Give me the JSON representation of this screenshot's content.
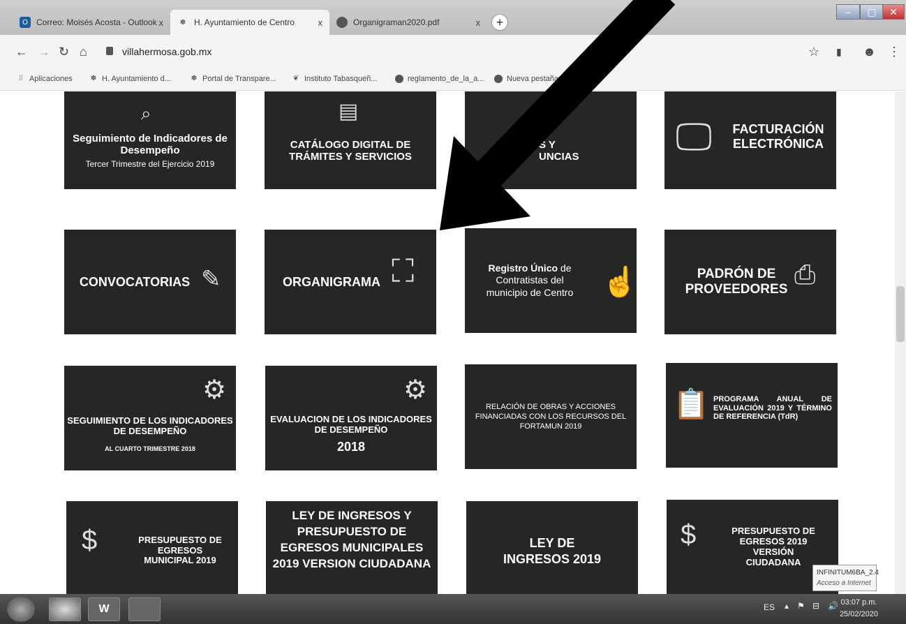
{
  "browser": {
    "tabs": [
      {
        "title": "Correo: Moisés Acosta - Outlook",
        "icon": "outlook-icon"
      },
      {
        "title": "H. Ayuntamiento de Centro",
        "icon": "palm-icon"
      },
      {
        "title": "Organigraman2020.pdf",
        "icon": "globe-icon"
      }
    ],
    "tab_close": "x",
    "new_tab": "+",
    "url": "villahermosa.gob.mx",
    "bookmarks": [
      {
        "label": "Aplicaciones",
        "icon": "apps-grid-icon"
      },
      {
        "label": "H. Ayuntamiento d...",
        "icon": "palm-icon"
      },
      {
        "label": "Portal de Transpare...",
        "icon": "palm-icon"
      },
      {
        "label": "Instituto Tabasqueñ...",
        "icon": "leaf-icon"
      },
      {
        "label": "reglamento_de_la_a...",
        "icon": "globe-icon"
      },
      {
        "label": "Nueva pestaña",
        "icon": "globe-icon"
      }
    ]
  },
  "tiles": [
    {
      "title": "Seguimiento de Indicadores de Desempeño",
      "sub": "Tercer Trimestre del Ejercicio 2019"
    },
    {
      "title": "CATÁLOGO DIGITAL DE TRÁMITES Y SERVICIOS"
    },
    {
      "title": "S Y UNCIAS"
    },
    {
      "title": "FACTURACIÓN ELECTRÓNICA"
    },
    {
      "title": "CONVOCATORIAS"
    },
    {
      "title": "ORGANIGRAMA"
    },
    {
      "title_bold": "Registro Único",
      "title_rest": " de Contratistas del municipio de Centro"
    },
    {
      "title": "PADRÓN DE PROVEEDORES"
    },
    {
      "title": "SEGUIMIENTO DE LOS INDICADORES DE DESEMPEÑO",
      "sub": "AL CUARTO TRIMESTRE 2018"
    },
    {
      "title": "EVALUACION DE LOS INDICADORES DE DESEMPEÑO",
      "sub": "2018"
    },
    {
      "title": "RELACIÓN DE OBRAS Y ACCIONES FINANCIADAS CON LOS RECURSOS DEL FORTAMUN 2019"
    },
    {
      "title": "PROGRAMA ANUAL DE EVALUACIÓN 2019 Y TÉRMINO DE REFERENCIA (TdR)"
    },
    {
      "title": "PRESUPUESTO DE EGRESOS MUNICIPAL 2019"
    },
    {
      "title": "LEY DE INGRESOS Y PRESUPUESTO DE EGRESOS MUNICIPALES 2019 VERSION CIUDADANA"
    },
    {
      "title": "LEY DE INGRESOS 2019"
    },
    {
      "title": "PRESUPUESTO DE EGRESOS 2019 VERSIÓN CIUDADANA"
    }
  ],
  "taskbar": {
    "word_label": "W",
    "lang": "ES",
    "time": "03:07 p.m.",
    "date": "25/02/2020",
    "tooltip_title": "INFINITUM6BA_2.4",
    "tooltip_sub": "Acceso a Internet"
  }
}
